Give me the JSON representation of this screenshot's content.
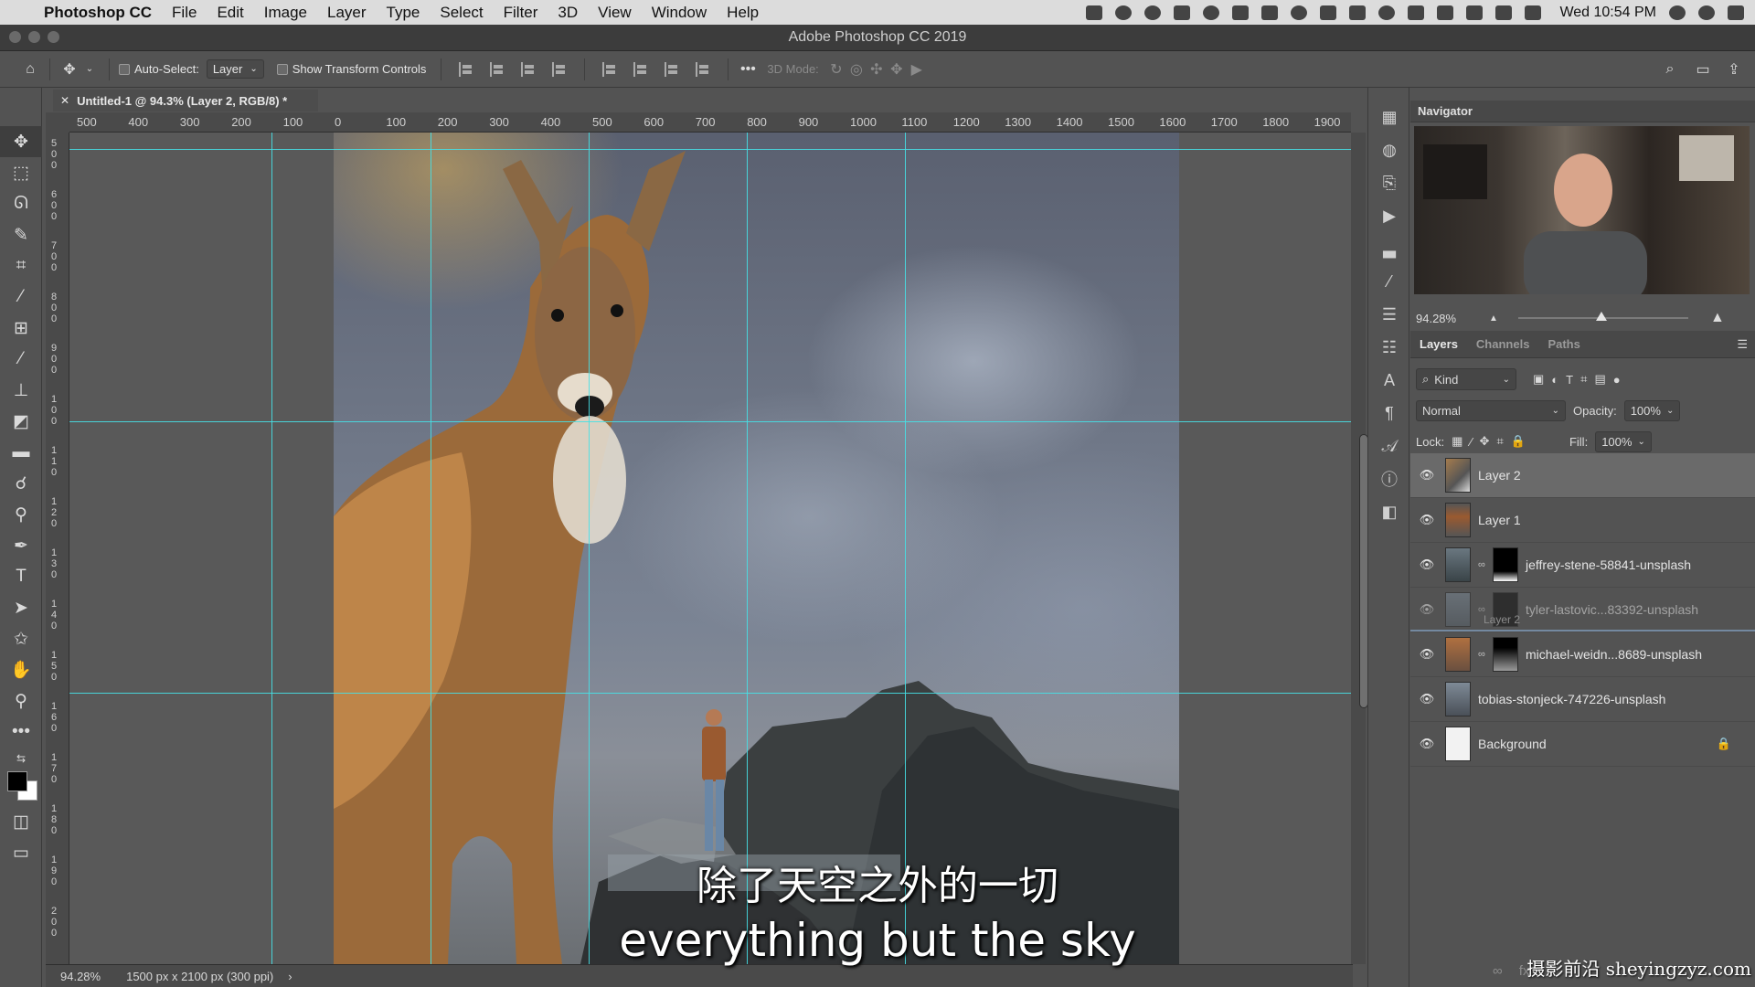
{
  "menubar": {
    "app_name": "Photoshop CC",
    "items": [
      "File",
      "Edit",
      "Image",
      "Layer",
      "Type",
      "Select",
      "Filter",
      "3D",
      "View",
      "Window",
      "Help"
    ],
    "clock": "Wed 10:54 PM"
  },
  "window": {
    "title": "Adobe Photoshop CC 2019"
  },
  "options_bar": {
    "auto_select_label": "Auto-Select:",
    "auto_select_value": "Layer",
    "show_transform_label": "Show Transform Controls",
    "mode_3d_label": "3D Mode:"
  },
  "document": {
    "tab_title": "Untitled-1 @ 94.3% (Layer 2, RGB/8) *",
    "ruler_top_labels": [
      "500",
      "400",
      "300",
      "200",
      "100",
      "0",
      "100",
      "200",
      "300",
      "400",
      "500",
      "600",
      "700",
      "800",
      "900",
      "1000",
      "1100",
      "1200",
      "1300",
      "1400",
      "1500",
      "1600",
      "1700",
      "1800",
      "1900"
    ],
    "ruler_left_labels": [
      "5 0 0",
      "6 0 0",
      "7 0 0",
      "8 0 0",
      "9 0 0",
      "1 0 0",
      "1 1 0",
      "1 2 0",
      "1 3 0",
      "1 4 0",
      "1 5 0",
      "1 6 0",
      "1 7 0",
      "1 8 0",
      "1 9 0",
      "2 0 0"
    ]
  },
  "status_bar": {
    "zoom": "94.28%",
    "doc_info": "1500 px x 2100 px (300 ppi)"
  },
  "subtitle": {
    "chinese": "除了天空之外的一切",
    "english": "everything but the sky"
  },
  "navigator": {
    "title": "Navigator",
    "zoom": "94.28%"
  },
  "layers_panel": {
    "tabs": [
      "Layers",
      "Channels",
      "Paths"
    ],
    "filter_kind": "Kind",
    "blend_mode": "Normal",
    "opacity_label": "Opacity:",
    "opacity_value": "100%",
    "lock_label": "Lock:",
    "fill_label": "Fill:",
    "fill_value": "100%",
    "layers": [
      {
        "name": "Layer 2",
        "selected": true
      },
      {
        "name": "Layer 1"
      },
      {
        "name": "jeffrey-stene-58841-unsplash"
      },
      {
        "name": "tyler-lastovic...83392-unsplash",
        "ghost_label": "Layer 2"
      },
      {
        "name": "michael-weidn...8689-unsplash"
      },
      {
        "name": "tobias-stonjeck-747226-unsplash"
      },
      {
        "name": "Background"
      }
    ]
  },
  "watermark": "摄影前沿 sheyingzyz.com"
}
